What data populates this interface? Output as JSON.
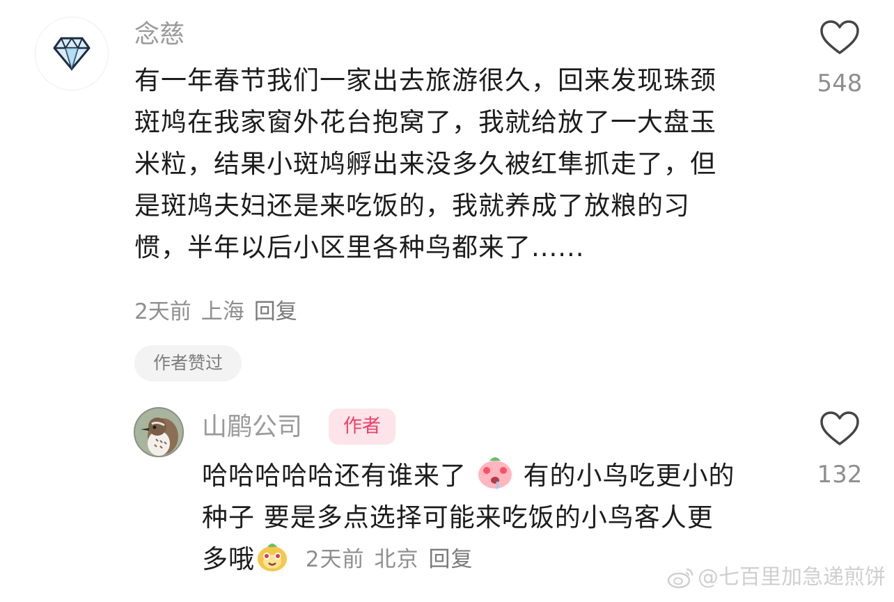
{
  "comment": {
    "username": "念慈",
    "avatar_icon": "diamond-icon",
    "lines": [
      "有一年春节我们一家出去旅游很久，回来发现珠颈",
      "斑鸠在我家窗外花台抱窝了，我就给放了一大盘玉",
      "米粒，结果小斑鸠孵出来没多久被红隼抓走了，但",
      "是斑鸠夫妇还是来吃饭的，我就养成了放粮的习",
      "惯，半年以后小区里各种鸟都来了......"
    ],
    "time": "2天前",
    "location": "上海",
    "reply": "回复",
    "author_liked": "作者赞过",
    "likes": "548"
  },
  "reply": {
    "username": "山鹛公司",
    "badge": "作者",
    "avatar_icon": "bird-avatar",
    "line1_a": "哈哈哈哈哈还有谁来了",
    "line1_b": "有的小鸟吃更小的",
    "line2": "种子 要是多点选择可能来吃饭的小鸟客人更",
    "line3": "多哦",
    "time": "2天前",
    "location": "北京",
    "reply": "回复",
    "likes": "132"
  },
  "watermark": {
    "icon": "weibo-icon",
    "text": "@七百里加急递煎饼"
  },
  "colors": {
    "badge_bg": "#fde4ea",
    "badge_text": "#ee3f68",
    "meta_text": "#8e8e8e"
  }
}
